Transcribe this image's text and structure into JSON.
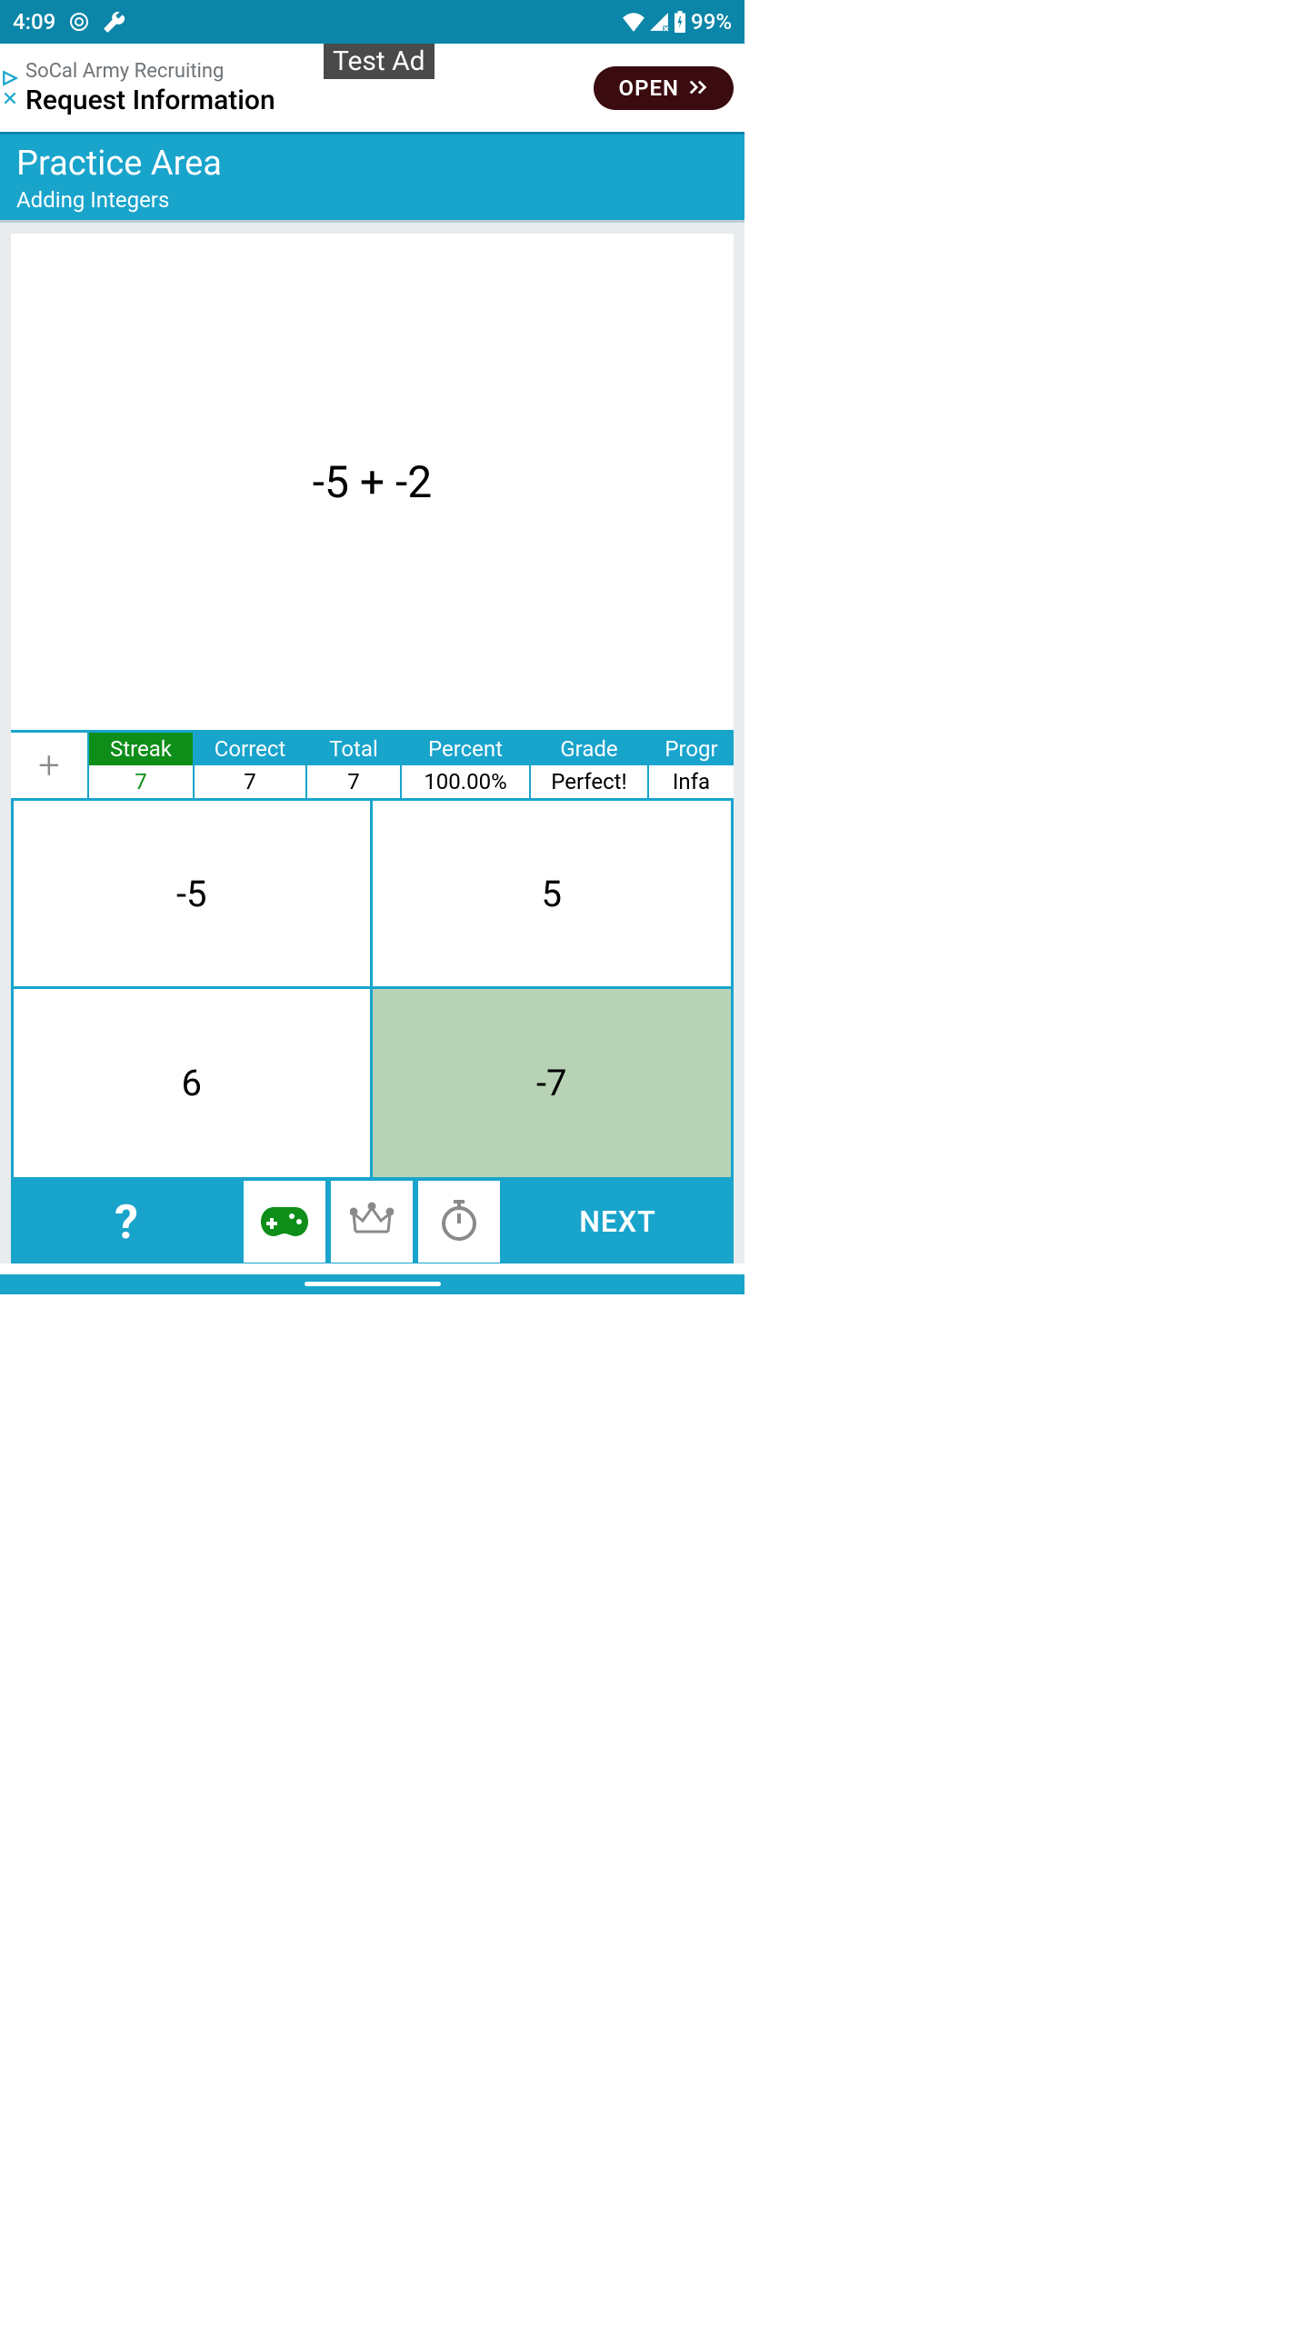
{
  "status": {
    "time": "4:09",
    "battery": "99%"
  },
  "ad": {
    "line1": "SoCal Army Recruiting",
    "line2": "Request Information",
    "tag": "Test Ad",
    "cta": "OPEN"
  },
  "header": {
    "title": "Practice Area",
    "subtitle": "Adding Integers"
  },
  "question": {
    "expression": "-5 + -2"
  },
  "stats": {
    "streak": {
      "label": "Streak",
      "value": "7"
    },
    "correct": {
      "label": "Correct",
      "value": "7"
    },
    "total": {
      "label": "Total",
      "value": "7"
    },
    "percent": {
      "label": "Percent",
      "value": "100.00%"
    },
    "grade": {
      "label": "Grade",
      "value": "Perfect!"
    },
    "progress": {
      "label": "Progr",
      "value": "Infa"
    }
  },
  "answers": {
    "a0": "-5",
    "a1": "5",
    "a2": "6",
    "a3": "-7",
    "selected_index": 3
  },
  "bottombar": {
    "help": "?",
    "next": "NEXT",
    "icons": {
      "game": "gamepad-icon",
      "crown": "crown-icon",
      "timer": "stopwatch-icon"
    }
  }
}
